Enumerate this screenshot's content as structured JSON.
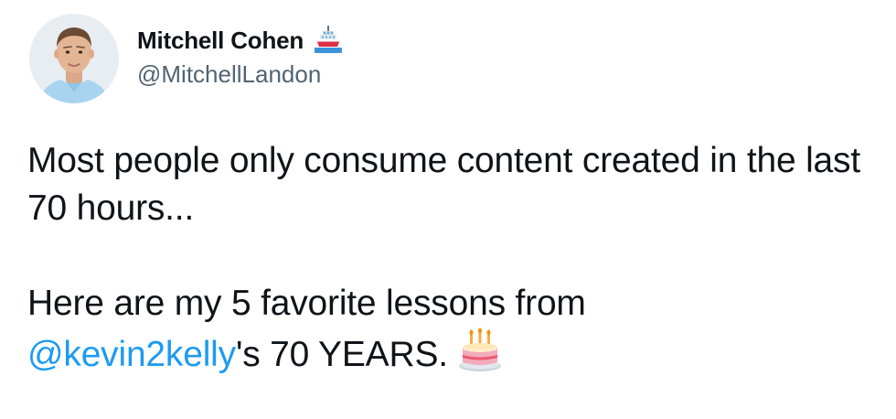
{
  "author": {
    "display_name": "Mitchell Cohen",
    "name_emoji": "ship-icon",
    "handle": "@MitchellLandon",
    "avatar": "avatar-photo"
  },
  "tweet": {
    "paragraph1": "Most people only consume content created in the last 70 hours...",
    "paragraph2_prefix": "Here are my 5 favorite lessons from",
    "mention": "@kevin2kelly",
    "paragraph2_suffix": "'s 70 YEARS.",
    "end_emoji": "cake-icon"
  },
  "colors": {
    "text": "#0f1419",
    "secondary": "#536471",
    "link": "#1d9bf0"
  }
}
